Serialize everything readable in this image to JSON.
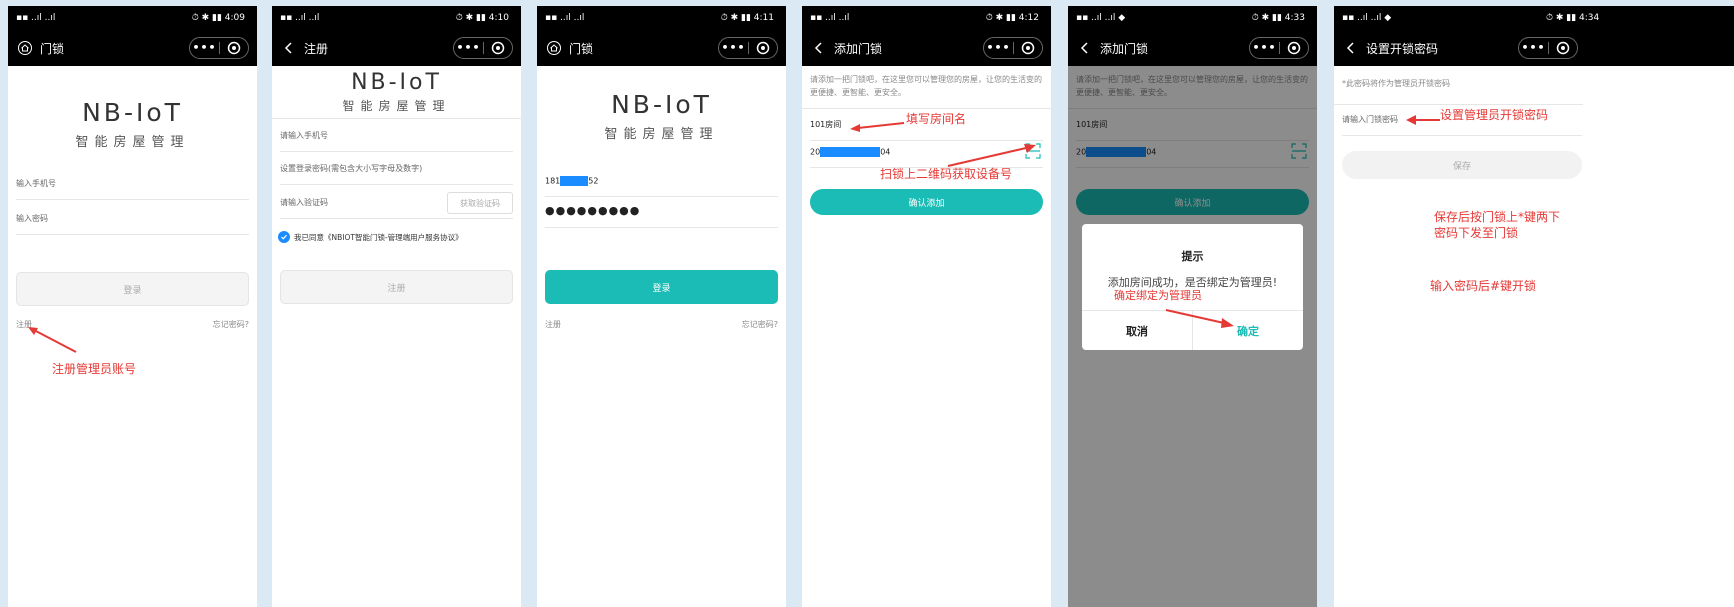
{
  "screens": [
    {
      "status_time": "4:09",
      "status_right": "⏱ ✱ ▮▮ 4:09",
      "title": "门锁",
      "logo_main": "NB-IoT",
      "logo_sub": "智能房屋管理",
      "phone_placeholder": "输入手机号",
      "password_placeholder": "输入密码",
      "login_button": "登录",
      "register_link": "注册",
      "forgot_link": "忘记密码?",
      "annotation": "注册管理员账号"
    },
    {
      "status_right": "⏱ ✱ ▮▮ 4:10",
      "title": "注册",
      "logo_main": "NB-IoT",
      "logo_sub": "智能房屋管理",
      "phone_placeholder": "请输入手机号",
      "password_placeholder": "设置登录密码(需包含大小写字母及数字)",
      "code_placeholder": "请输入验证码",
      "code_button": "获取验证码",
      "agreement": "我已同意《NBIOT智能门锁-管理端用户服务协议》",
      "register_button": "注册"
    },
    {
      "status_right": "⏱ ✱ ▮▮ 4:11",
      "title": "门锁",
      "logo_main": "NB-IoT",
      "logo_sub": "智能房屋管理",
      "phone_prefix": "181",
      "phone_suffix": "52",
      "password_dots": "●●●●●●●●●",
      "login_button": "登录",
      "register_link": "注册",
      "forgot_link": "忘记密码?"
    },
    {
      "status_right": "⏱ ✱ ▮▮ 4:12",
      "title": "添加门锁",
      "description": "请添加一把门锁吧，在这里您可以管理您的房屋，让您的生活变的更便捷、更智能、更安全。",
      "room_name": "101房间",
      "device_prefix": "20",
      "device_suffix": "04",
      "confirm_button": "确认添加",
      "annotation_room": "填写房间名",
      "annotation_scan": "扫锁上二维码获取设备号"
    },
    {
      "status_right": "⏱ ✱ ▮▮ 4:33",
      "title": "添加门锁",
      "description": "请添加一把门锁吧，在这里您可以管理您的房屋，让您的生活变的更便捷、更智能、更安全。",
      "room_name": "101房间",
      "device_prefix": "20",
      "device_suffix": "04",
      "confirm_button": "确认添加",
      "dialog_title": "提示",
      "dialog_message": "添加房间成功，是否绑定为管理员!",
      "dialog_cancel": "取消",
      "dialog_ok": "确定",
      "annotation": "确定绑定为管理员"
    },
    {
      "status_right": "⏱ ✱ ▮▮ 4:34",
      "title": "设置开锁密码",
      "note": "*此密码将作为管理员开锁密码",
      "password_placeholder": "请输入门锁密码",
      "save_button": "保存",
      "annotation_set": "设置管理员开锁密码",
      "annotation_save_line1": "保存后按门锁上*键两下",
      "annotation_save_line2": "密码下发至门锁",
      "annotation_unlock": "输入密码后#键开锁"
    }
  ],
  "colors": {
    "teal": "#1bbcb5",
    "annotation_red": "#e53935",
    "mask_blue": "#1a8cff",
    "background": "#dbe9f4"
  }
}
